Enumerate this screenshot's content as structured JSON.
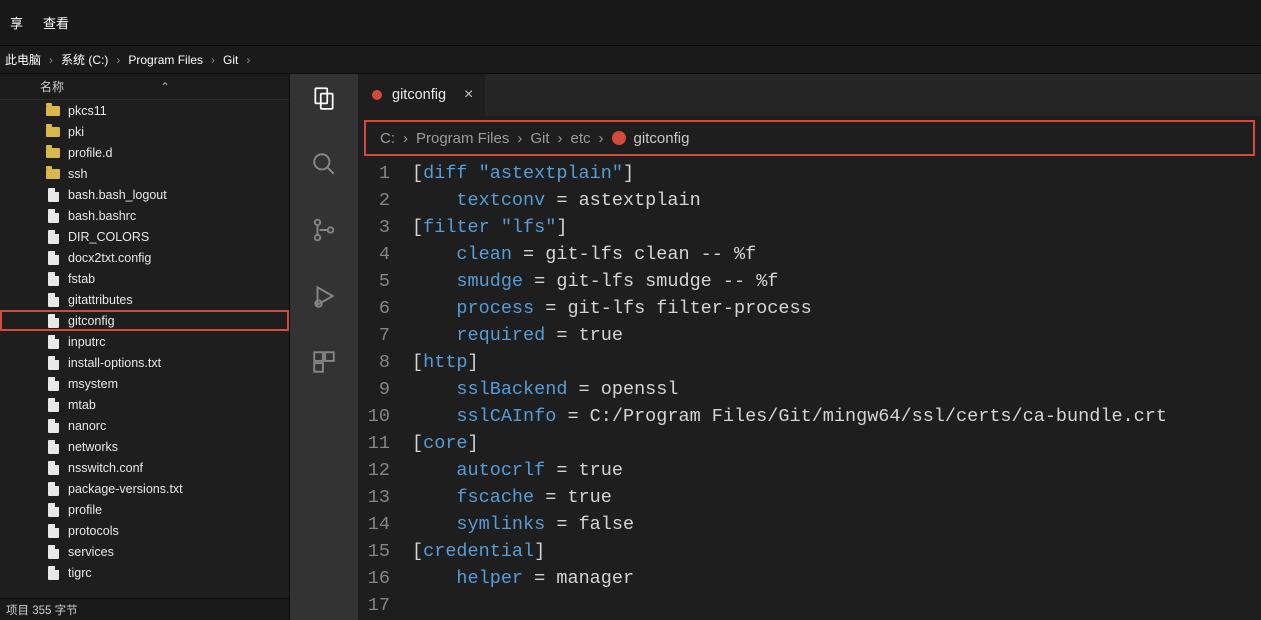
{
  "menu": {
    "share": "享",
    "view": "查看"
  },
  "explorer_breadcrumb": [
    "此电脑",
    "系统 (C:)",
    "Program Files",
    "Git"
  ],
  "fe_header": "名称",
  "fe_items": [
    {
      "name": "pkcs11",
      "type": "folder"
    },
    {
      "name": "pki",
      "type": "folder"
    },
    {
      "name": "profile.d",
      "type": "folder"
    },
    {
      "name": "ssh",
      "type": "folder"
    },
    {
      "name": "bash.bash_logout",
      "type": "file"
    },
    {
      "name": "bash.bashrc",
      "type": "file"
    },
    {
      "name": "DIR_COLORS",
      "type": "file"
    },
    {
      "name": "docx2txt.config",
      "type": "file"
    },
    {
      "name": "fstab",
      "type": "file"
    },
    {
      "name": "gitattributes",
      "type": "file"
    },
    {
      "name": "gitconfig",
      "type": "file",
      "highlight": true
    },
    {
      "name": "inputrc",
      "type": "file"
    },
    {
      "name": "install-options.txt",
      "type": "file"
    },
    {
      "name": "msystem",
      "type": "file"
    },
    {
      "name": "mtab",
      "type": "file"
    },
    {
      "name": "nanorc",
      "type": "file"
    },
    {
      "name": "networks",
      "type": "file"
    },
    {
      "name": "nsswitch.conf",
      "type": "file"
    },
    {
      "name": "package-versions.txt",
      "type": "file"
    },
    {
      "name": "profile",
      "type": "file"
    },
    {
      "name": "protocols",
      "type": "file"
    },
    {
      "name": "services",
      "type": "file"
    },
    {
      "name": "tigrc",
      "type": "file"
    }
  ],
  "fe_status": "项目   355 字节",
  "tab": {
    "name": "gitconfig"
  },
  "editor_breadcrumb": [
    "C:",
    "Program Files",
    "Git",
    "etc",
    "gitconfig"
  ],
  "code_lines": [
    [
      {
        "t": "pun",
        "v": "["
      },
      {
        "t": "key",
        "v": "diff \"astextplain\""
      },
      {
        "t": "pun",
        "v": "]"
      }
    ],
    [
      {
        "t": "indent",
        "v": "    "
      },
      {
        "t": "key",
        "v": "textconv"
      },
      {
        "t": "pun",
        "v": " = "
      },
      {
        "t": "val",
        "v": "astextplain"
      }
    ],
    [
      {
        "t": "pun",
        "v": "["
      },
      {
        "t": "key",
        "v": "filter \"lfs\""
      },
      {
        "t": "pun",
        "v": "]"
      }
    ],
    [
      {
        "t": "indent",
        "v": "    "
      },
      {
        "t": "key",
        "v": "clean"
      },
      {
        "t": "pun",
        "v": " = "
      },
      {
        "t": "val",
        "v": "git-lfs clean -- %f"
      }
    ],
    [
      {
        "t": "indent",
        "v": "    "
      },
      {
        "t": "key",
        "v": "smudge"
      },
      {
        "t": "pun",
        "v": " = "
      },
      {
        "t": "val",
        "v": "git-lfs smudge -- %f"
      }
    ],
    [
      {
        "t": "indent",
        "v": "    "
      },
      {
        "t": "key",
        "v": "process"
      },
      {
        "t": "pun",
        "v": " = "
      },
      {
        "t": "val",
        "v": "git-lfs filter-process"
      }
    ],
    [
      {
        "t": "indent",
        "v": "    "
      },
      {
        "t": "key",
        "v": "required"
      },
      {
        "t": "pun",
        "v": " = "
      },
      {
        "t": "val",
        "v": "true"
      }
    ],
    [
      {
        "t": "pun",
        "v": "["
      },
      {
        "t": "key",
        "v": "http"
      },
      {
        "t": "pun",
        "v": "]"
      }
    ],
    [
      {
        "t": "indent",
        "v": "    "
      },
      {
        "t": "key",
        "v": "sslBackend"
      },
      {
        "t": "pun",
        "v": " = "
      },
      {
        "t": "val",
        "v": "openssl"
      }
    ],
    [
      {
        "t": "indent",
        "v": "    "
      },
      {
        "t": "key",
        "v": "sslCAInfo"
      },
      {
        "t": "pun",
        "v": " = "
      },
      {
        "t": "val",
        "v": "C:/Program Files/Git/mingw64/ssl/certs/ca-bundle.crt"
      }
    ],
    [
      {
        "t": "pun",
        "v": "["
      },
      {
        "t": "key",
        "v": "core"
      },
      {
        "t": "pun",
        "v": "]"
      }
    ],
    [
      {
        "t": "indent",
        "v": "    "
      },
      {
        "t": "key",
        "v": "autocrlf"
      },
      {
        "t": "pun",
        "v": " = "
      },
      {
        "t": "val",
        "v": "true"
      }
    ],
    [
      {
        "t": "indent",
        "v": "    "
      },
      {
        "t": "key",
        "v": "fscache"
      },
      {
        "t": "pun",
        "v": " = "
      },
      {
        "t": "val",
        "v": "true"
      }
    ],
    [
      {
        "t": "indent",
        "v": "    "
      },
      {
        "t": "key",
        "v": "symlinks"
      },
      {
        "t": "pun",
        "v": " = "
      },
      {
        "t": "val",
        "v": "false"
      }
    ],
    [
      {
        "t": "pun",
        "v": "["
      },
      {
        "t": "key",
        "v": "credential"
      },
      {
        "t": "pun",
        "v": "]"
      }
    ],
    [
      {
        "t": "indent",
        "v": "    "
      },
      {
        "t": "key",
        "v": "helper"
      },
      {
        "t": "pun",
        "v": " = "
      },
      {
        "t": "val",
        "v": "manager"
      }
    ],
    []
  ]
}
